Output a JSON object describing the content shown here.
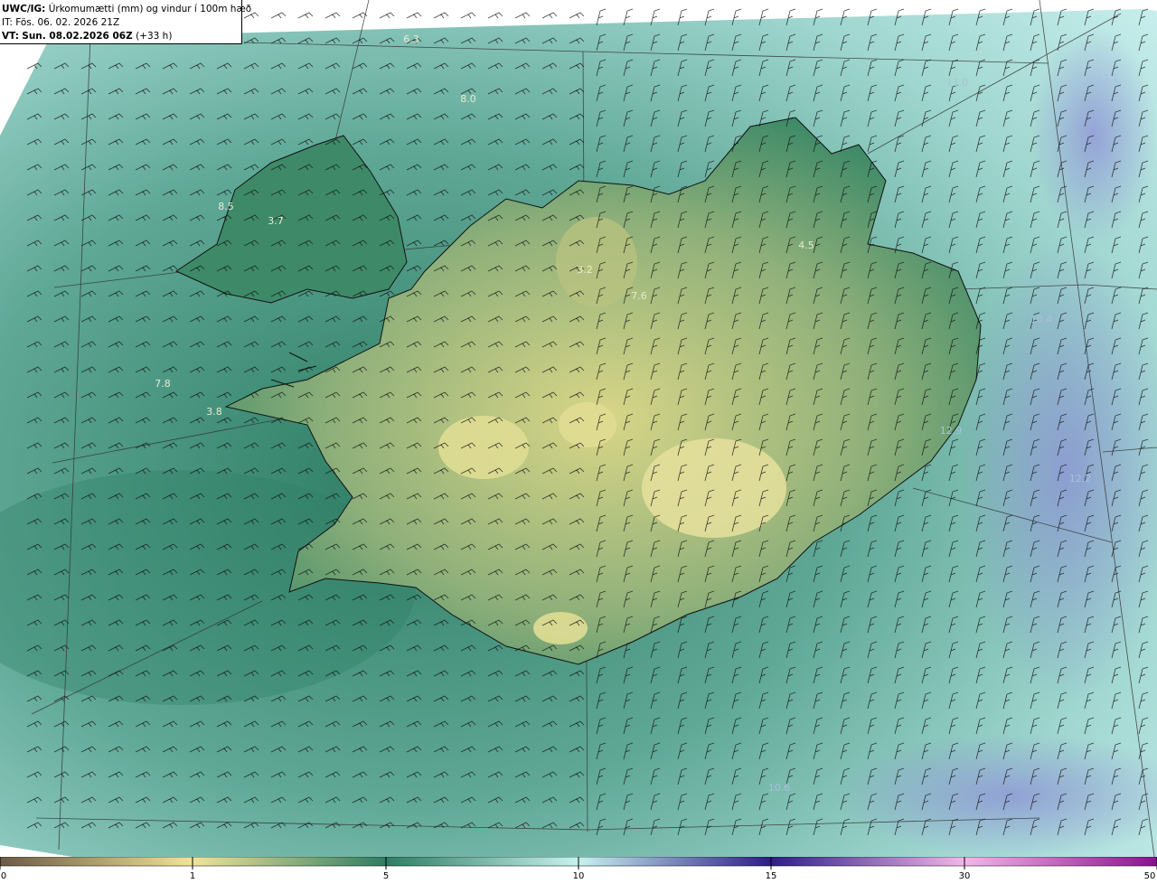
{
  "header": {
    "model": "UWC/IG:",
    "parameter": "Úrkomumætti (mm) og vindur í 100m hæð",
    "init_label": "IT:",
    "init_time": "Fös. 06. 02. 2026 21Z",
    "valid_label": "VT:",
    "valid_time": "Sun. 08.02.2026 06Z",
    "lead": "(+33 h)"
  },
  "colors": {
    "ocean_low": "#2e7d63",
    "ocean_mid": "#5fa896",
    "ocean_high": "#b9e6e3",
    "land_high": "#d8d687",
    "coast": "#1a1a1a",
    "heavy": "#8c8fd6"
  },
  "colorbar": {
    "ticks": [
      "0",
      "1",
      "5",
      "10",
      "15",
      "30",
      "50"
    ],
    "stops": [
      "#6b5a45",
      "#f2e39a",
      "#2e7d63",
      "#c8f2ef",
      "#2c1d86",
      "#f4b6e8",
      "#8b0f8e"
    ]
  },
  "values": [
    {
      "text": "6.3"
    },
    {
      "text": "8.0"
    },
    {
      "text": "3.7"
    },
    {
      "text": "8.5"
    },
    {
      "text": "7.8"
    },
    {
      "text": "3.8"
    },
    {
      "text": "3.2"
    },
    {
      "text": "7.6"
    },
    {
      "text": "4.5"
    },
    {
      "text": "12.2"
    },
    {
      "text": "11.0"
    },
    {
      "text": "10.4"
    },
    {
      "text": "12.9"
    },
    {
      "text": "10.6"
    },
    {
      "text": "12.1"
    }
  ]
}
